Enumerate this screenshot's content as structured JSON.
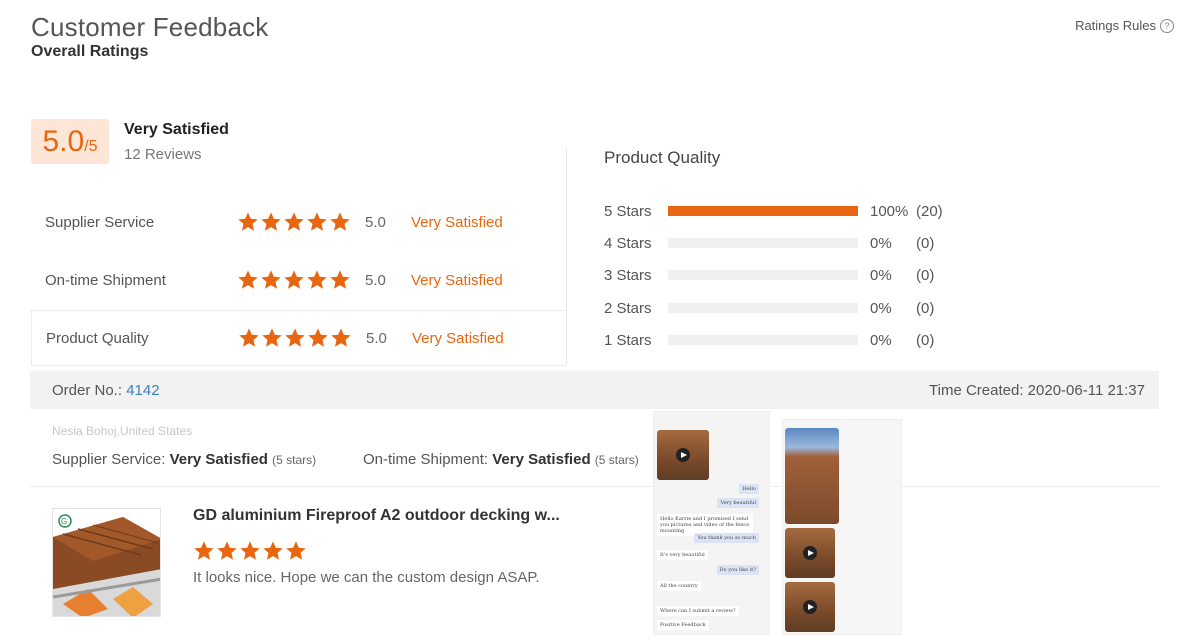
{
  "header": {
    "title": "Customer Feedback",
    "subtitle": "Overall Ratings",
    "rules_label": "Ratings Rules",
    "rules_icon": "?"
  },
  "overall": {
    "score": "5.0",
    "denominator": "/5",
    "verdict": "Very Satisfied",
    "reviews": "12 Reviews"
  },
  "categories": [
    {
      "label": "Supplier Service",
      "stars": 5,
      "score": "5.0",
      "verdict": "Very Satisfied"
    },
    {
      "label": "On-time Shipment",
      "stars": 5,
      "score": "5.0",
      "verdict": "Very Satisfied"
    },
    {
      "label": "Product Quality",
      "stars": 5,
      "score": "5.0",
      "verdict": "Very Satisfied"
    }
  ],
  "distribution": {
    "title": "Product Quality",
    "rows": [
      {
        "label": "5  Stars",
        "fraction": 1.0,
        "pct": "100%",
        "count": "(20)"
      },
      {
        "label": "4  Stars",
        "fraction": 0,
        "pct": "0%",
        "count": "(0)"
      },
      {
        "label": "3  Stars",
        "fraction": 0,
        "pct": "0%",
        "count": "(0)"
      },
      {
        "label": "2  Stars",
        "fraction": 0,
        "pct": "0%",
        "count": "(0)"
      },
      {
        "label": "1  Stars",
        "fraction": 0,
        "pct": "0%",
        "count": "(0)"
      }
    ]
  },
  "order": {
    "label": "Order No.:",
    "number": "4142",
    "time_label": "Time Created:",
    "time": "2020-06-11 21:37",
    "location": "Nesia Bohoj,United States",
    "service_label": "Supplier Service:",
    "service_value": "Very Satisfied",
    "service_stars": "(5 stars)",
    "shipment_label": "On-time Shipment:",
    "shipment_value": "Very Satisfied",
    "shipment_stars": "(5 stars)"
  },
  "review": {
    "product_title": "GD aluminium Fireproof A2 outdoor decking w...",
    "stars": 5,
    "comment": "It looks nice. Hope we can the custom design ASAP."
  },
  "chat": {
    "messages": [
      {
        "text": "Hello",
        "me": true
      },
      {
        "text": "Very beautiful",
        "me": true
      },
      {
        "text": "Hello Karrie and I promised I send you pictures and video of the fence mounting",
        "me": false
      },
      {
        "text": "You thank you so much",
        "me": true
      },
      {
        "text": "It's very beautiful",
        "me": false
      },
      {
        "text": "Do you like it?",
        "me": true
      },
      {
        "text": "All the country",
        "me": false
      },
      {
        "text": "Where can I submit a review?",
        "me": false
      },
      {
        "text": "Positive Feedback",
        "me": false
      }
    ]
  },
  "colors": {
    "accent": "#e8660f",
    "accent_bg": "#fde6d6",
    "link": "#3a7fc1",
    "bar_bg": "#f0f0f0",
    "order_bg": "#f2f2f2"
  }
}
